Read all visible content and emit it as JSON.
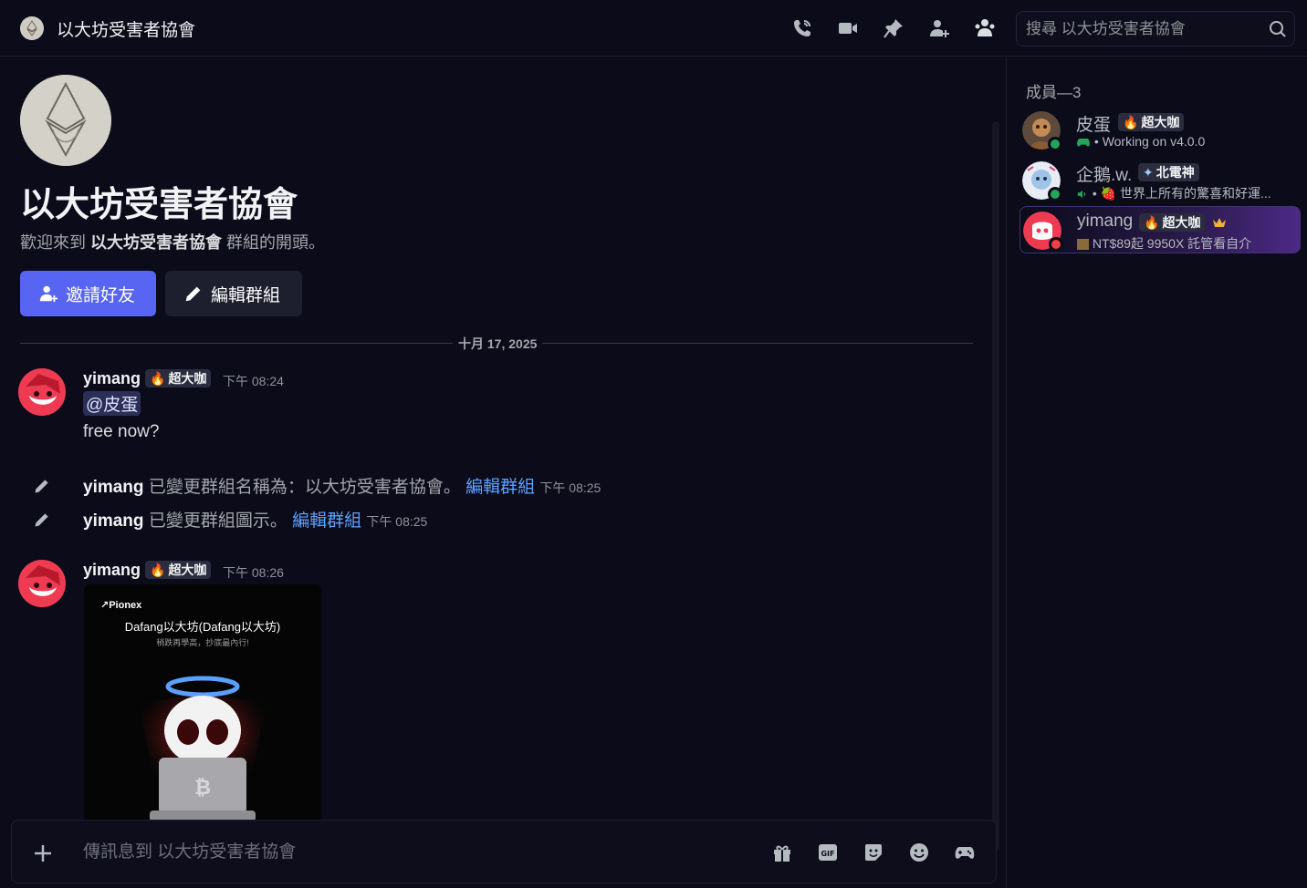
{
  "header": {
    "title": "以大坊受害者協會",
    "search_placeholder": "搜尋 以大坊受害者協會",
    "icons": [
      "phone-icon",
      "video-icon",
      "pin-icon",
      "add-friend-icon",
      "members-icon",
      "search-icon"
    ]
  },
  "intro": {
    "title": "以大坊受害者協會",
    "welcome_prefix": "歡迎來到",
    "welcome_name": "以大坊受害者協會",
    "welcome_suffix": "群組的開頭。",
    "invite_label": "邀請好友",
    "edit_label": "編輯群組"
  },
  "date_divider": "十月 17, 2025",
  "messages": [
    {
      "author": "yimang",
      "tag": "超大咖",
      "time": "下午 08:24",
      "mention": "@皮蛋",
      "text": "free now?"
    },
    {
      "author": "yimang",
      "tag": "超大咖",
      "time": "下午 08:26",
      "image": {
        "brand": "Pionex",
        "title": "Dafang以大坊(Dafang以大坊)",
        "subtitle": "稍跌再學高，抄底最內行!"
      }
    }
  ],
  "system_messages": [
    {
      "who": "yimang",
      "action": "已變更群組名稱為：以大坊受害者協會。",
      "link": "編輯群組",
      "time": "下午 08:25"
    },
    {
      "who": "yimang",
      "action": "已變更群組圖示。",
      "link": "編輯群組",
      "time": "下午 08:25"
    }
  ],
  "composer": {
    "placeholder": "傳訊息到 以大坊受害者協會",
    "icons": [
      "add-icon",
      "gift-icon",
      "gif-icon",
      "sticker-icon",
      "emoji-icon",
      "game-icon"
    ]
  },
  "members": {
    "title": "成員—3",
    "list": [
      {
        "name": "皮蛋",
        "tag": "超大咖",
        "status_text": "Working on v4.0.0",
        "presence": "online"
      },
      {
        "name": "企鵝.w.",
        "tag": "北電神",
        "status_text": "世界上所有的驚喜和好運...",
        "presence": "online"
      },
      {
        "name": "yimang",
        "tag": "超大咖",
        "status_text": "NT$89起 9950X 託管看自介",
        "presence": "dnd"
      }
    ]
  },
  "colors": {
    "background": "#0b0b1a",
    "accent": "#5865f2",
    "link": "#5ea1ff",
    "online": "#23a55a",
    "dnd": "#f23f43"
  }
}
